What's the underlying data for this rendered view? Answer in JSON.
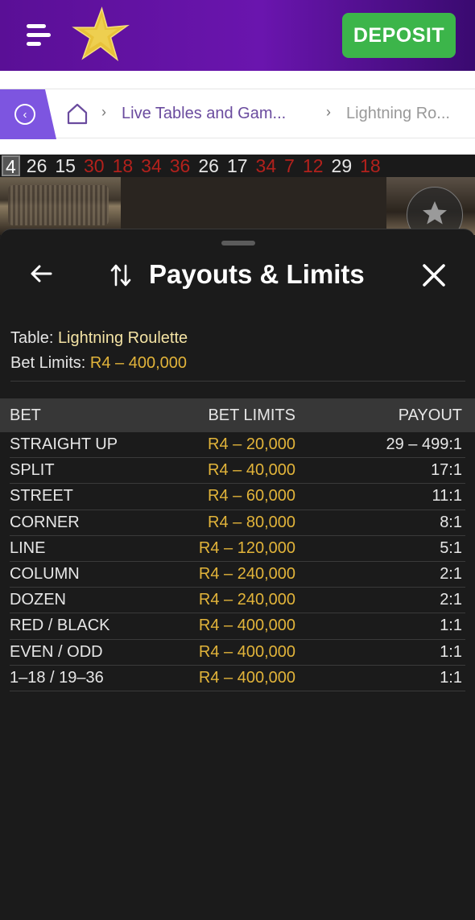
{
  "header": {
    "deposit_label": "DEPOSIT",
    "brand_color": "#6a15ae",
    "deposit_color": "#3cb54a"
  },
  "breadcrumb": {
    "items": [
      "Live Tables and Gam...",
      "Lightning Ro..."
    ]
  },
  "history": {
    "numbers": [
      {
        "n": "4",
        "color": "black",
        "current": true
      },
      {
        "n": "26",
        "color": "black"
      },
      {
        "n": "15",
        "color": "black"
      },
      {
        "n": "30",
        "color": "red"
      },
      {
        "n": "18",
        "color": "red"
      },
      {
        "n": "34",
        "color": "red"
      },
      {
        "n": "36",
        "color": "red"
      },
      {
        "n": "26",
        "color": "black"
      },
      {
        "n": "17",
        "color": "black"
      },
      {
        "n": "34",
        "color": "red"
      },
      {
        "n": "7",
        "color": "red"
      },
      {
        "n": "12",
        "color": "red"
      },
      {
        "n": "29",
        "color": "black"
      },
      {
        "n": "18",
        "color": "red"
      }
    ]
  },
  "sheet": {
    "title": "Payouts & Limits",
    "table_label": "Table:",
    "table_name": "Lightning Roulette",
    "limits_label": "Bet Limits:",
    "limits_value": "R4 – 400,000",
    "columns": {
      "bet": "BET",
      "limits": "BET LIMITS",
      "payout": "PAYOUT"
    },
    "rows": [
      {
        "bet": "STRAIGHT UP",
        "limits": "R4 – 20,000",
        "payout": "29 – 499:1"
      },
      {
        "bet": "SPLIT",
        "limits": "R4 – 40,000",
        "payout": "17:1"
      },
      {
        "bet": "STREET",
        "limits": "R4 – 60,000",
        "payout": "11:1"
      },
      {
        "bet": "CORNER",
        "limits": "R4 – 80,000",
        "payout": "8:1"
      },
      {
        "bet": "LINE",
        "limits": "R4 – 120,000",
        "payout": "5:1"
      },
      {
        "bet": "COLUMN",
        "limits": "R4 – 240,000",
        "payout": "2:1"
      },
      {
        "bet": "DOZEN",
        "limits": "R4 – 240,000",
        "payout": "2:1"
      },
      {
        "bet": "RED / BLACK",
        "limits": "R4 – 400,000",
        "payout": "1:1"
      },
      {
        "bet": "EVEN / ODD",
        "limits": "R4 – 400,000",
        "payout": "1:1"
      },
      {
        "bet": "1–18 / 19–36",
        "limits": "R4 – 400,000",
        "payout": "1:1"
      }
    ]
  },
  "icons": {
    "menu": "hamburger-menu-icon",
    "logo": "star-logo-icon",
    "back": "chevron-left-circle-icon",
    "home": "home-icon",
    "favorite": "star-icon",
    "sheet_back": "arrow-left-icon",
    "sort": "sort-arrows-icon",
    "close": "close-icon"
  }
}
